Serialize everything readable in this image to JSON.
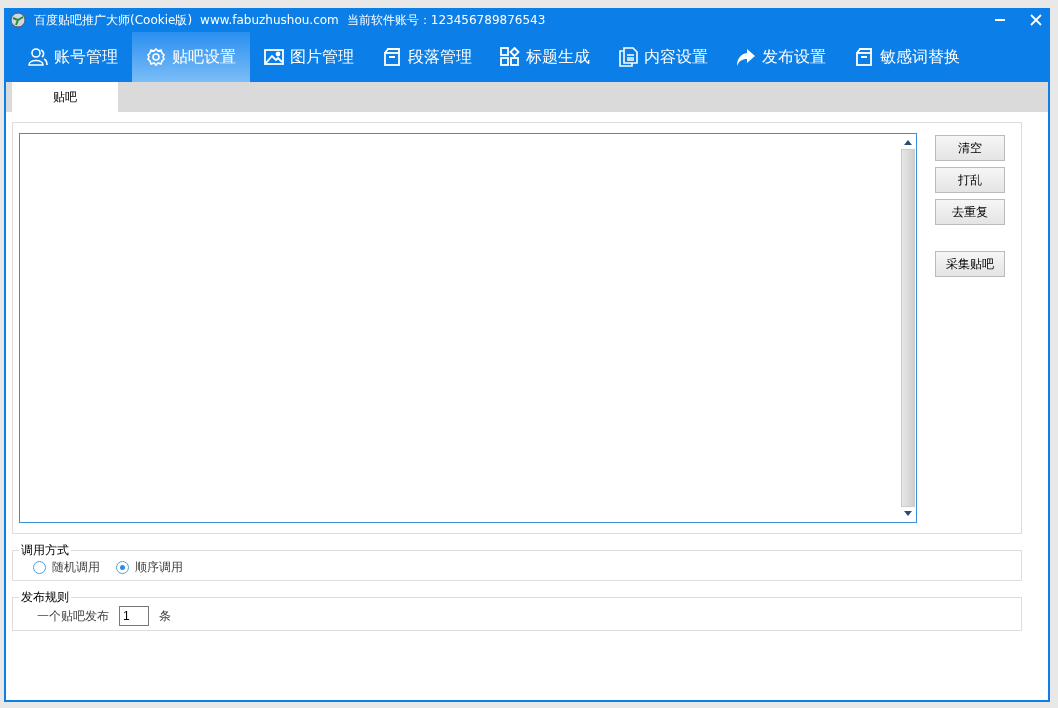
{
  "window": {
    "title": "百度贴吧推广大师(Cookie版)",
    "url": "www.fabuzhushou.com",
    "account_label": "当前软件账号：123456789876543"
  },
  "nav": [
    {
      "label": "账号管理",
      "kind": "user",
      "selected": false
    },
    {
      "label": "贴吧设置",
      "kind": "gear",
      "selected": true
    },
    {
      "label": "图片管理",
      "kind": "image",
      "selected": false
    },
    {
      "label": "段落管理",
      "kind": "box",
      "selected": false
    },
    {
      "label": "标题生成",
      "kind": "grid",
      "selected": false
    },
    {
      "label": "内容设置",
      "kind": "doc",
      "selected": false
    },
    {
      "label": "发布设置",
      "kind": "share",
      "selected": false
    },
    {
      "label": "敏感词替换",
      "kind": "box",
      "selected": false
    }
  ],
  "tabs": [
    {
      "label": "贴吧",
      "selected": true
    }
  ],
  "side_buttons": [
    "清空",
    "打乱",
    "去重复",
    "采集贴吧"
  ],
  "call_mode": {
    "title": "调用方式",
    "options": [
      {
        "label": "随机调用",
        "selected": false
      },
      {
        "label": "顺序调用",
        "selected": true
      }
    ]
  },
  "publish_rule": {
    "title": "发布规则",
    "label": "一个贴吧发布",
    "value": "1",
    "unit": "条"
  }
}
